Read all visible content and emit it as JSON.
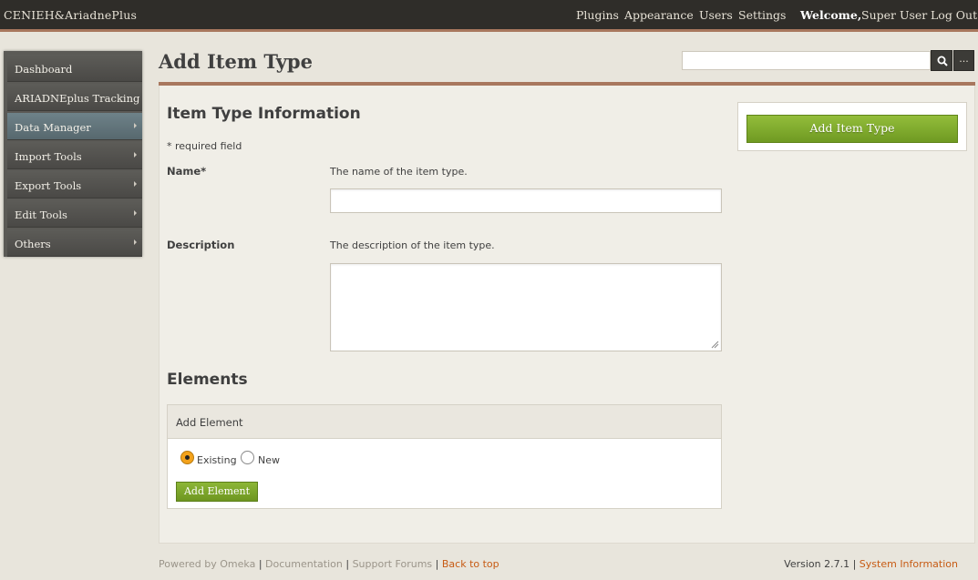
{
  "header": {
    "site_title": "CENIEH&AriadnePlus",
    "nav": {
      "plugins": "Plugins",
      "appearance": "Appearance",
      "users": "Users",
      "settings": "Settings"
    },
    "welcome": "Welcome,",
    "user_name": "Super User",
    "logout": "Log Out"
  },
  "sidebar": {
    "items": [
      {
        "label": "Dashboard",
        "active": false,
        "submenu": false
      },
      {
        "label": "ARIADNEplus Tracking",
        "active": false,
        "submenu": false
      },
      {
        "label": "Data Manager",
        "active": true,
        "submenu": true
      },
      {
        "label": "Import Tools",
        "active": false,
        "submenu": true
      },
      {
        "label": "Export Tools",
        "active": false,
        "submenu": true
      },
      {
        "label": "Edit Tools",
        "active": false,
        "submenu": true
      },
      {
        "label": "Others",
        "active": false,
        "submenu": true
      }
    ]
  },
  "page": {
    "title": "Add Item Type",
    "search": {
      "value": "",
      "options_label": "..."
    }
  },
  "form": {
    "section_heading": "Item Type Information",
    "required_note": "* required field",
    "name": {
      "label": "Name*",
      "explanation": "The name of the item type.",
      "value": ""
    },
    "description": {
      "label": "Description",
      "explanation": "The description of the item type.",
      "value": ""
    },
    "elements_heading": "Elements",
    "add_element": {
      "title": "Add Element",
      "options": [
        {
          "label": "Existing",
          "selected": true
        },
        {
          "label": "New",
          "selected": false
        }
      ],
      "button_label": "Add Element"
    }
  },
  "save_panel": {
    "button_label": "Add Item Type"
  },
  "footer": {
    "powered_by": "Powered by Omeka",
    "documentation": "Documentation",
    "support_forums": "Support Forums",
    "back_to_top": "Back to top",
    "version": "Version 2.7.1 |",
    "system_info": "System Information",
    "separator": "|"
  },
  "colors": {
    "topbar": "#2f2d29",
    "accent_rule": "#a8775e",
    "primary_button": "#7ba82a",
    "link": "#c75b14"
  }
}
